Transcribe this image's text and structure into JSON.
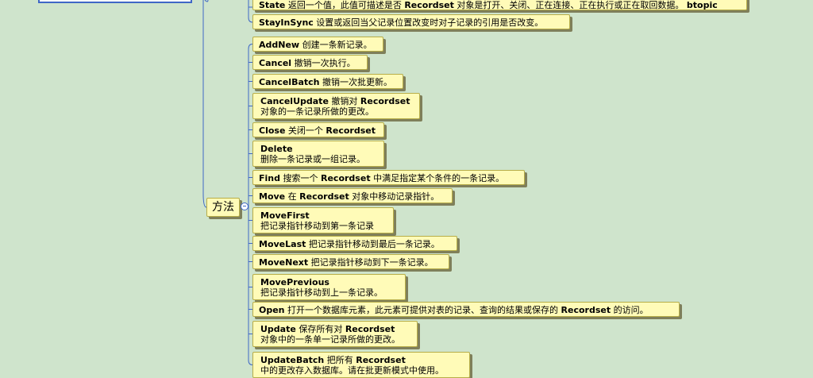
{
  "colors": {
    "background": "#cfe4cc",
    "node_fill": "#fffbb8",
    "node_border": "#b7ad48",
    "connector": "#3f67c6"
  },
  "parent_node": {
    "label": "方法"
  },
  "top_nodes": [
    {
      "name": "State",
      "desc": "返回一个值，此值可描述是否 Recordset 对象是打开、关闭、正在连接、正在执行或正在取回数据。 btopic"
    },
    {
      "name": "StayInSync",
      "desc": "设置或返回当父记录位置改变时对子记录的引用是否改变。"
    }
  ],
  "methods": [
    {
      "name": "AddNew",
      "desc": "创建一条新记录。"
    },
    {
      "name": "Cancel",
      "desc": "撤销一次执行。"
    },
    {
      "name": "CancelBatch",
      "desc": "撤销一次批更新。"
    },
    {
      "name": "CancelUpdate",
      "desc": "撤销对 Recordset",
      "desc2": "对象的一条记录所做的更改。"
    },
    {
      "name": "Close",
      "desc": "关闭一个 Recordset"
    },
    {
      "name": "Delete",
      "desc": "",
      "desc2": "删除一条记录或一组记录。"
    },
    {
      "name": "Find",
      "desc": "搜索一个 Recordset 中满足指定某个条件的一条记录。"
    },
    {
      "name": "Move",
      "desc": "在 Recordset 对象中移动记录指针。"
    },
    {
      "name": "MoveFirst",
      "desc": "",
      "desc2": "把记录指针移动到第一条记录"
    },
    {
      "name": "MoveLast",
      "desc": "把记录指针移动到最后一条记录。"
    },
    {
      "name": "MoveNext",
      "desc": "把记录指针移动到下一条记录。"
    },
    {
      "name": "MovePrevious",
      "desc": "",
      "desc2": "把记录指针移动到上一条记录。"
    },
    {
      "name": "Open",
      "desc": "打开一个数据库元素，此元素可提供对表的记录、查询的结果或保存的 Recordset 的访问。"
    },
    {
      "name": "Update",
      "desc": "保存所有对 Recordset",
      "desc2": "对象中的一条单一记录所做的更改。"
    },
    {
      "name": "UpdateBatch",
      "desc": "把所有 Recordset",
      "desc2": "中的更改存入数据库。请在批更新模式中使用。"
    }
  ]
}
